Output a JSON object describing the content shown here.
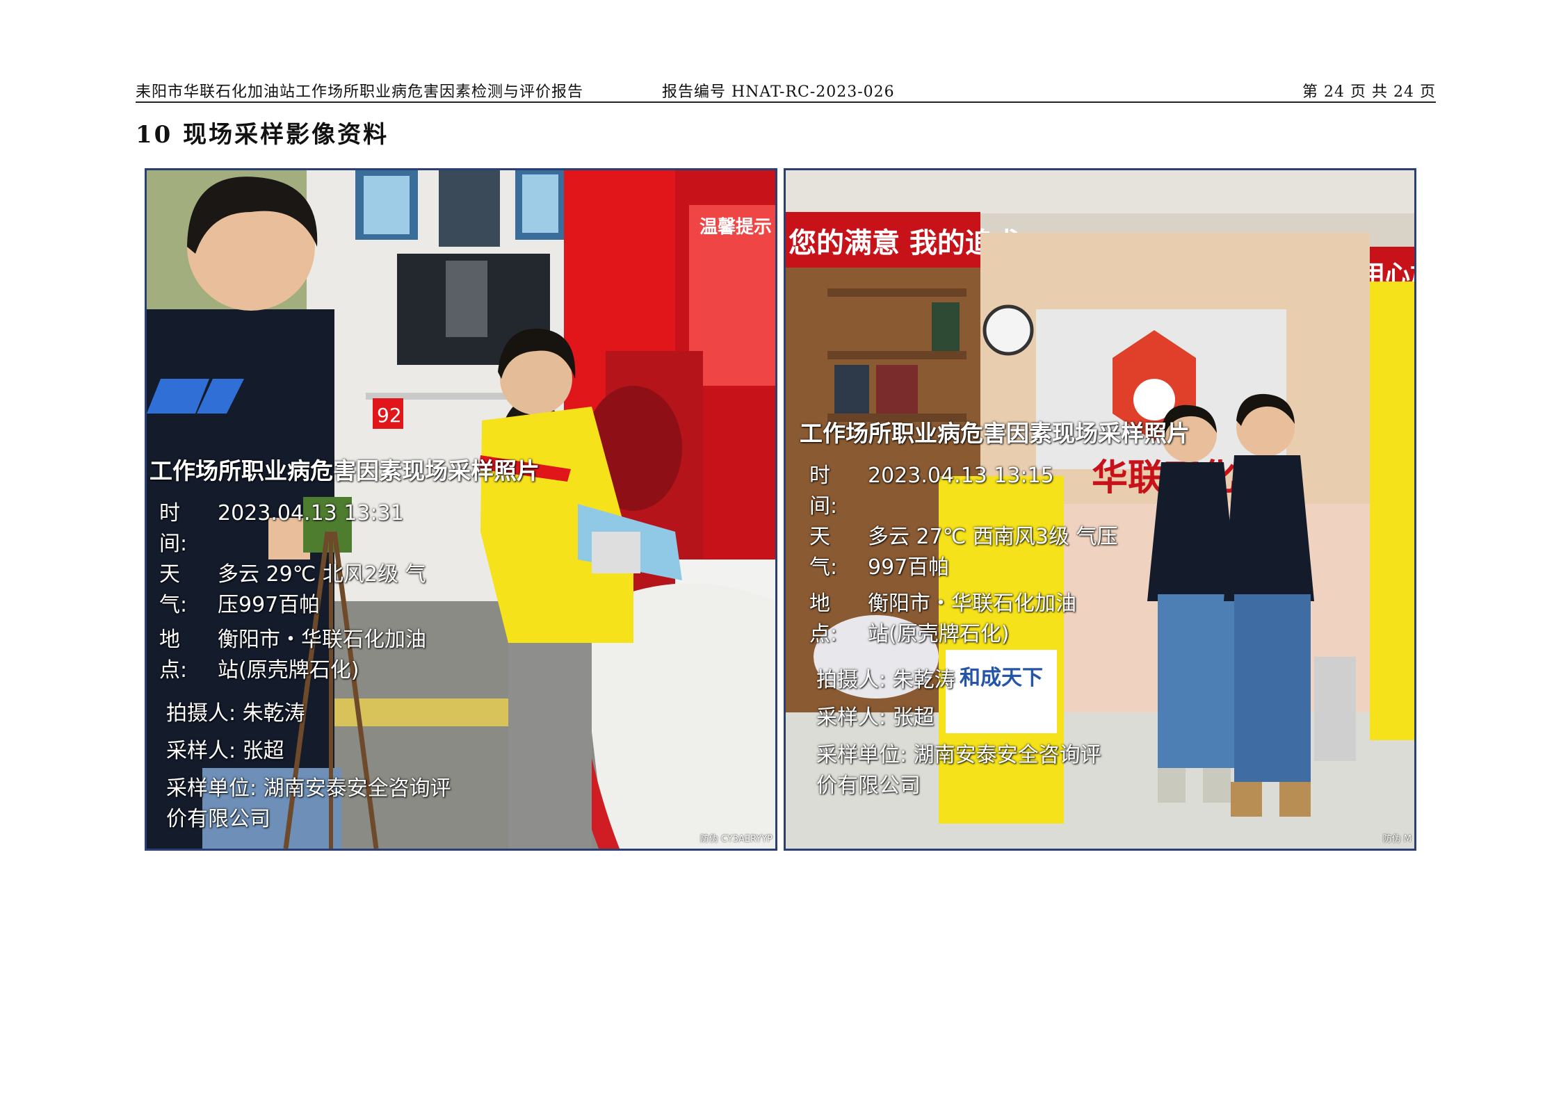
{
  "header": {
    "report_name": "耒阳市华联石化加油站工作场所职业病危害因素检测与评价报告",
    "report_number": "报告编号 HNAT-RC-2023-026",
    "page_info": "第 24 页 共 24 页"
  },
  "section_title": "10 现场采样影像资料",
  "photos": [
    {
      "overlay_title": "工作场所职业病危害因素现场采样照片",
      "time_label": "时　间:",
      "time_value": "2023.04.13 13:31",
      "weather_label": "天　气:",
      "weather_value": "多云 29℃ 北风2级 气压997百帕",
      "location_label": "地　点:",
      "location_value": "衡阳市・华联石化加油站(原壳牌石化)",
      "photographer": "拍摄人: 朱乾涛",
      "sampler": "采样人: 张超",
      "unit": "采样单位: 湖南安泰安全咨询评价有限公司",
      "watermark": "防伪 CY3AERYYP",
      "sign_title": "温馨提示",
      "pump_number": "92"
    },
    {
      "overlay_title": "工作场所职业病危害因素现场采样照片",
      "time_label": "时　间:",
      "time_value": "2023.04.13 13:15",
      "weather_label": "天　气:",
      "weather_value": "多云 27℃ 西南风3级 气压997百帕",
      "location_label": "地　点:",
      "location_value": "衡阳市・华联石化加油站(原壳牌石化)",
      "photographer": "拍摄人: 朱乾涛",
      "sampler": "采样人: 张超",
      "unit": "采样单位: 湖南安泰安全咨询评价有限公司",
      "watermark": "防伪 M",
      "banner_left": "您的满意 我的追求",
      "banner_right": "用心加",
      "store_sign": "华联石化",
      "display_text": "和成天下"
    }
  ],
  "colors": {
    "frame_border": "#2a3f73",
    "station_red": "#e0161b",
    "vest_yellow": "#f5e21a",
    "shirt_navy": "#141c2c"
  }
}
